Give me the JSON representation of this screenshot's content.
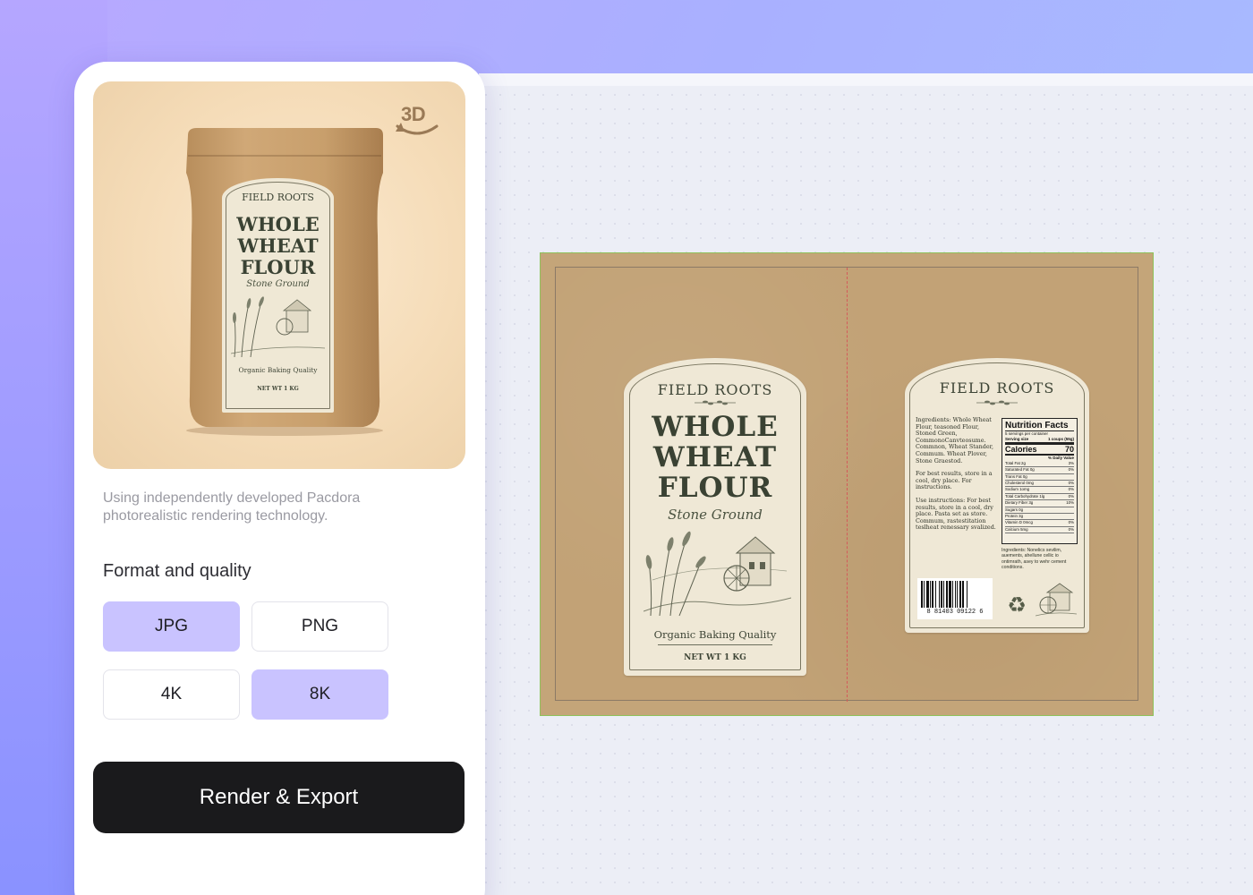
{
  "preview": {
    "badge_3d": "3D",
    "product": {
      "brand": "FIELD ROOTS",
      "title_lines": [
        "WHOLE",
        "WHEAT",
        "FLOUR"
      ],
      "subtitle": "Stone Ground",
      "quality": "Organic Baking Quality",
      "net_weight": "NET WT 1 KG"
    }
  },
  "description": "Using independently developed Pacdora photorealistic rendering technology.",
  "format_section": {
    "title": "Format and quality",
    "formats": [
      {
        "label": "JPG",
        "selected": true
      },
      {
        "label": "PNG",
        "selected": false
      }
    ],
    "qualities": [
      {
        "label": "4K",
        "selected": false
      },
      {
        "label": "8K",
        "selected": true
      }
    ]
  },
  "cta": {
    "label": "Render & Export"
  },
  "dieline": {
    "front_label": {
      "brand": "FIELD ROOTS",
      "title_lines": [
        "WHOLE",
        "WHEAT",
        "FLOUR"
      ],
      "subtitle": "Stone Ground",
      "quality": "Organic Baking Quality",
      "net_weight": "NET WT 1 KG"
    },
    "back_label": {
      "brand": "FIELD ROOTS",
      "paragraphs": [
        "Ingredients: Whole Wheat Flour, teasoned Flour, Stoned Green, CommonoCanvteosume. Commnon, Wheat Stander, Commum. Wheat Plover, Stone Graestod.",
        "For best results, store in a cool, dry place. For instructions.",
        "Use instructions: For best results, store in a cool, dry place. Pasta set as store. Commum, rastestitation teslheat renessary svalized."
      ],
      "nutrition": {
        "title": "Nutrition Facts",
        "servings": "5 servings per container",
        "serving_size_label": "Serving size",
        "serving_size_value": "1 coups (55g)",
        "amount_label": "Amount per serving",
        "calories_label": "Calories",
        "calories_value": "70",
        "dv_header": "% Daily Value",
        "rows": [
          {
            "name": "Total Fat 2g",
            "dv": "3%"
          },
          {
            "name": "Saturated Fat 0g",
            "dv": "0%"
          },
          {
            "name": "Trans Fat 0g",
            "dv": ""
          },
          {
            "name": "Cholesterol 0mg",
            "dv": "0%"
          },
          {
            "name": "Sodium 1omg",
            "dv": "0%"
          },
          {
            "name": "Total Carbohydrate 1lg",
            "dv": "0%"
          },
          {
            "name": "Dietary Fiber 3g",
            "dv": "10%"
          },
          {
            "name": "Sugars 0g",
            "dv": ""
          },
          {
            "name": "Protein 3g",
            "dv": ""
          },
          {
            "name": "Vitamin D 0mcg",
            "dv": "0%"
          },
          {
            "name": "Calcium 5mg",
            "dv": "0%"
          }
        ]
      },
      "ingredients_note": "Ingredients: Nonelics sevilim, auements, ahellune cellic io ontimrath, asey to wehr cement conditions.",
      "barcode_number": "8 81403 09122 6"
    }
  },
  "colors": {
    "accent_selected": "#c9c3ff",
    "cta_bg": "#1a1a1c",
    "kraft": "#c2a276",
    "label_cream": "#efe8d6",
    "fold_line": "#d45a5a",
    "dieline_outline": "#8fc25a"
  },
  "icons": [
    "rotate-3d-icon",
    "recycle-icon",
    "wheat-mill-illustration"
  ]
}
